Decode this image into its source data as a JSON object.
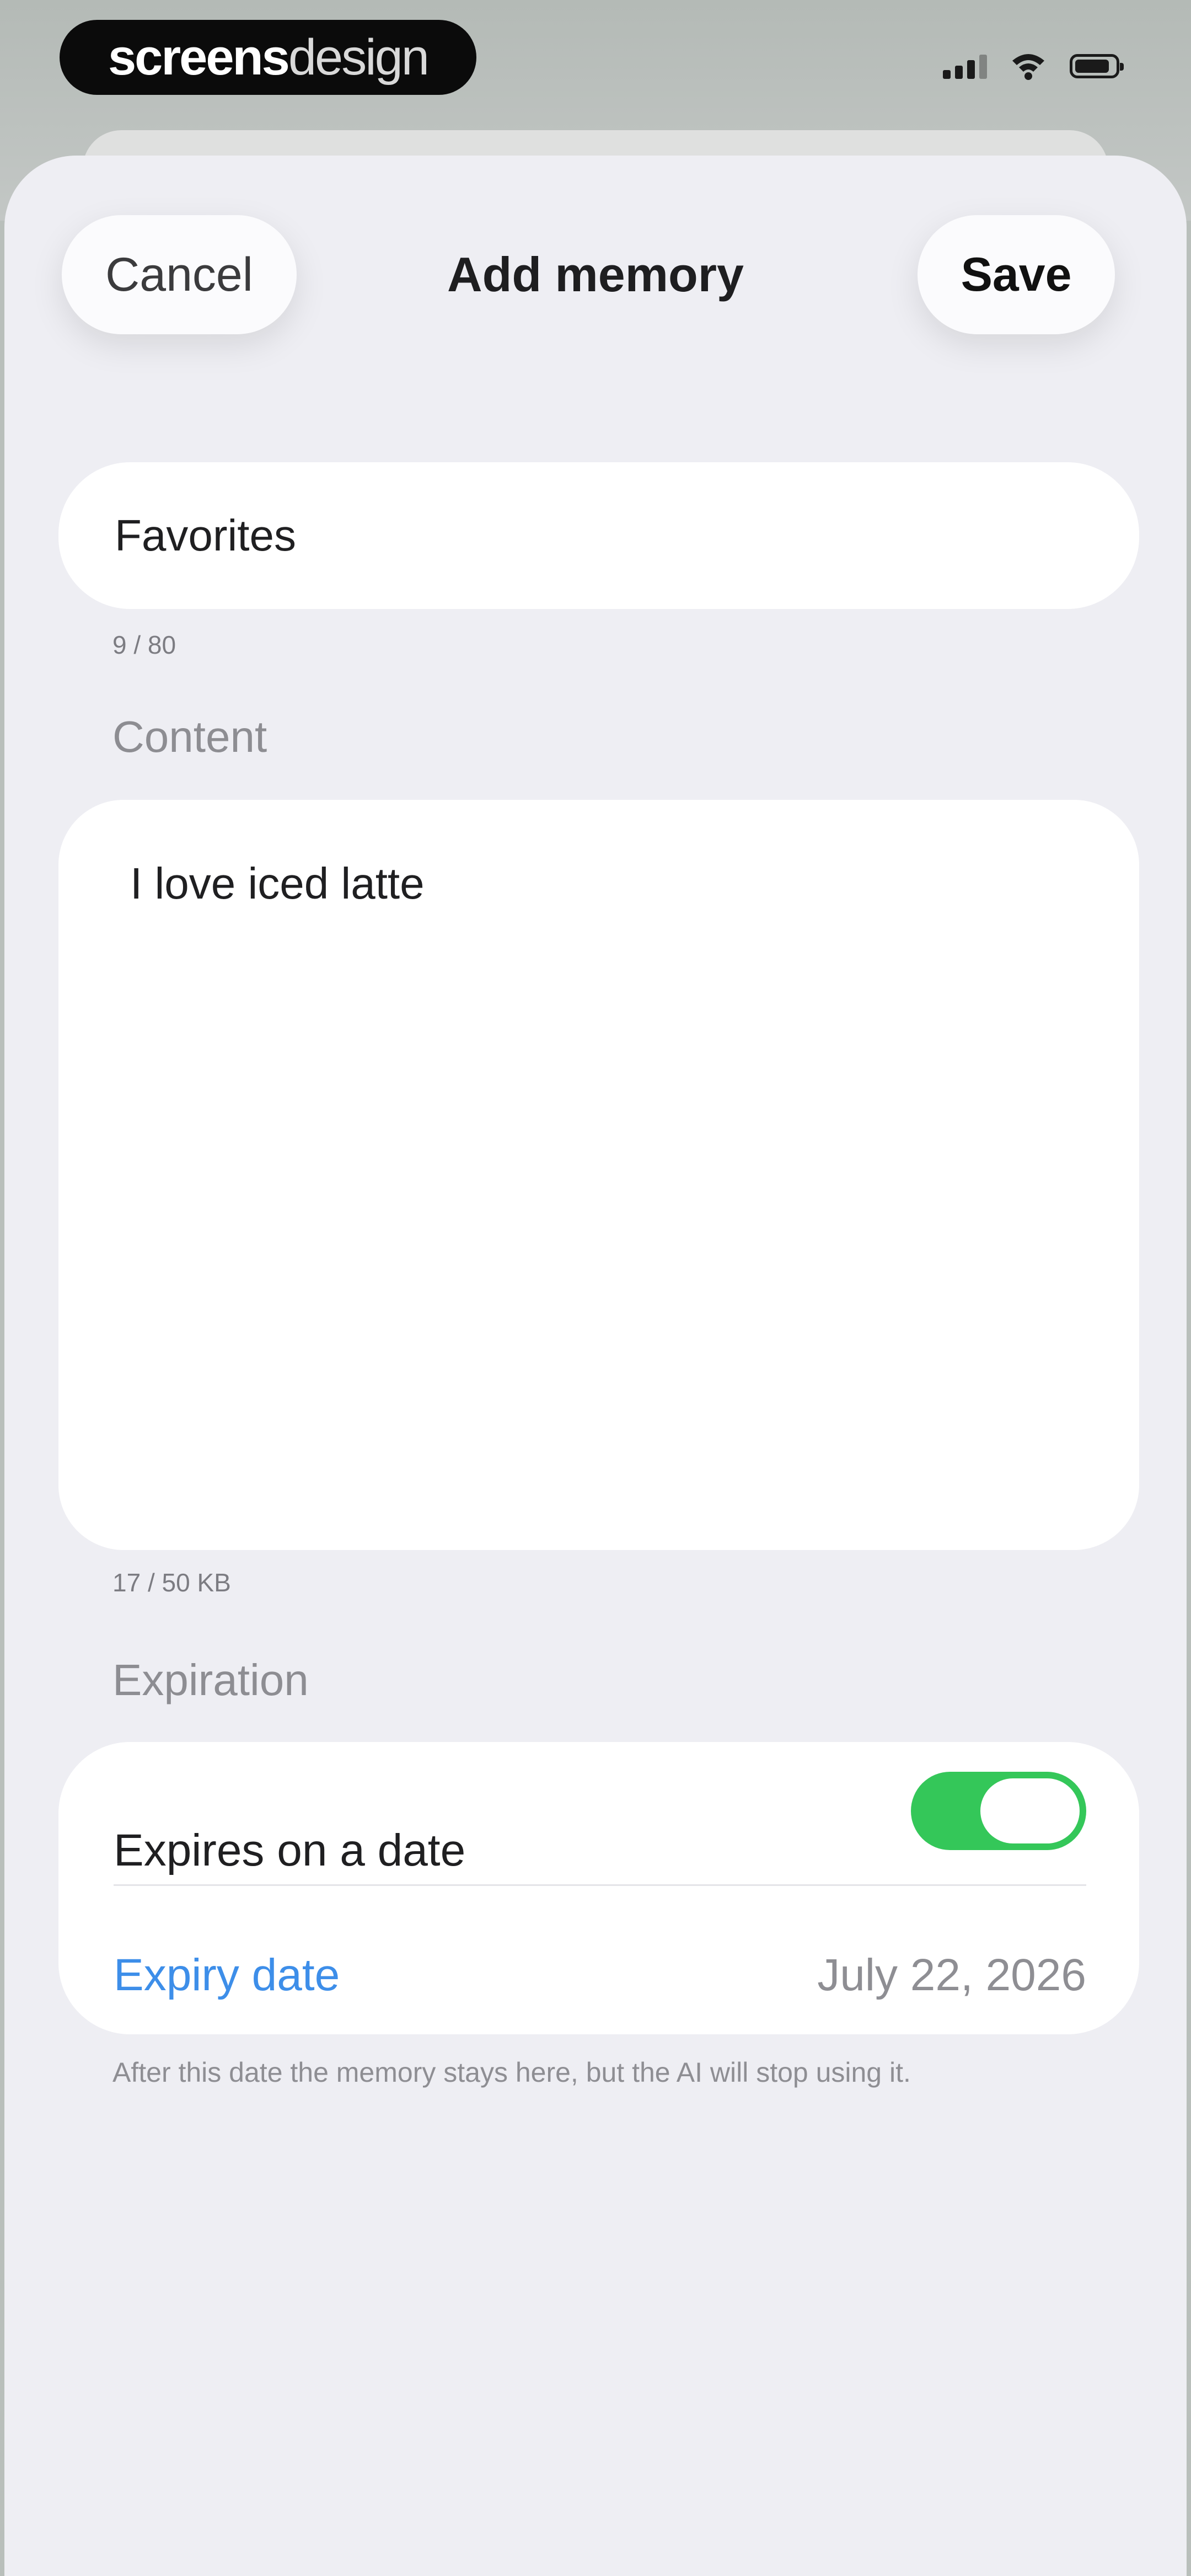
{
  "status_bar": {
    "brand_part1": "screens",
    "brand_part2": "design"
  },
  "header": {
    "cancel_label": "Cancel",
    "title": "Add memory",
    "save_label": "Save"
  },
  "title_field": {
    "value": "Favorites",
    "counter": "9 / 80"
  },
  "content_section": {
    "label": "Content",
    "value": "I love iced latte",
    "counter": "17 / 50 KB"
  },
  "expiration_section": {
    "label": "Expiration",
    "toggle_label": "Expires on a date",
    "toggle_on": true,
    "expiry_label": "Expiry date",
    "expiry_value": "July 22, 2026",
    "footnote": "After this date the memory stays here, but the AI will stop using it."
  },
  "colors": {
    "accent": "#3d8ee9",
    "toggle_on": "#34c759",
    "sheet_bg": "#eeeef3"
  },
  "icons": [
    "signal-icon",
    "wifi-icon",
    "battery-icon"
  ]
}
